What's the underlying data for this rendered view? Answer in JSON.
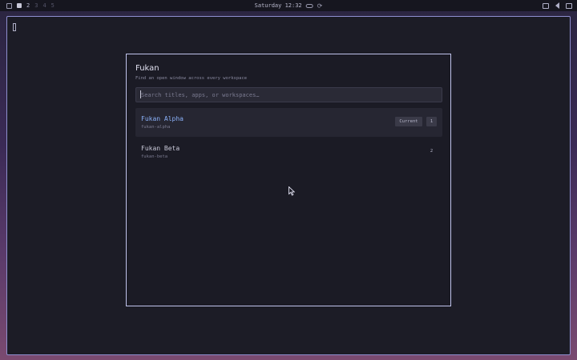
{
  "topbar": {
    "workspaces": [
      "2",
      "3",
      "4",
      "5"
    ],
    "clock": "Saturday 12:32"
  },
  "dialog": {
    "title": "Fukan",
    "subtitle": "Find an open window across every workspace",
    "search_placeholder": "Search titles, apps, or workspaces…",
    "results": [
      {
        "title": "Fukan Alpha",
        "app": "fukan-alpha",
        "current_label": "Current",
        "workspace": "1",
        "active": true
      },
      {
        "title": "Fukan Beta",
        "app": "fukan-beta",
        "workspace": "2",
        "active": false
      }
    ]
  },
  "colors": {
    "accent": "#8ab0f8",
    "border": "#c0c4ec",
    "window_border": "#8f8fd0"
  }
}
